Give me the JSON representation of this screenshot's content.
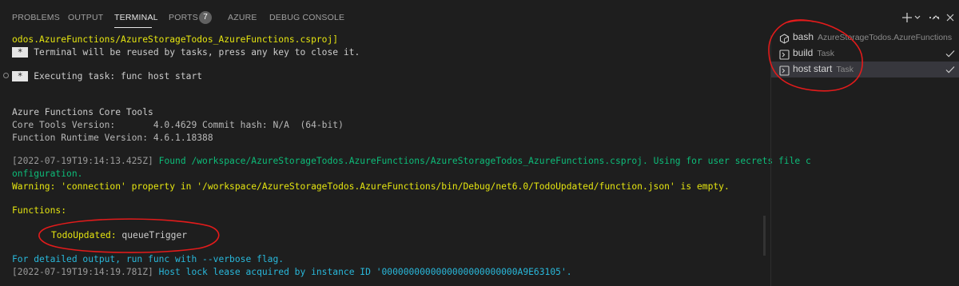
{
  "panel_tabs": {
    "problems": "PROBLEMS",
    "output": "OUTPUT",
    "terminal": "TERMINAL",
    "ports": "PORTS",
    "ports_badge": "7",
    "azure": "AZURE",
    "debug_console": "DEBUG CONSOLE"
  },
  "toolbar_icons": [
    "plus-icon",
    "chevron-down-icon",
    "more-icon",
    "chevron-up-icon",
    "close-icon"
  ],
  "terminal": {
    "line1": "odos.AzureFunctions/AzureStorageTodos_AzureFunctions.csproj]",
    "marker": " * ",
    "reuse_text": " Terminal will be reused by tasks, press any key to close it.",
    "exec_text": " Executing task: func host start",
    "core_tools_title": "Azure Functions Core Tools",
    "core_version": "Core Tools Version:       4.0.4629 Commit hash: N/A  (64-bit)",
    "runtime_version": "Function Runtime Version: 4.6.1.18388",
    "found_ts": "[2022-07-19T19:14:13.425Z]",
    "found_text": " Found /workspace/AzureStorageTodos.AzureFunctions/AzureStorageTodos_AzureFunctions.csproj. Using for user secrets file c",
    "found_text2": "onfiguration.",
    "warning": "Warning: 'connection' property in '/workspace/AzureStorageTodos.AzureFunctions/bin/Debug/net6.0/TodoUpdated/function.json' is empty.",
    "functions_header": "Functions:",
    "function_name": "TodoUpdated:",
    "function_trigger": " queueTrigger",
    "verbose_hint": "For detailed output, run func with --verbose flag.",
    "lock_ts": "[2022-07-19T19:14:19.781Z]",
    "lock_text": " Host lock lease acquired by instance ID '0000000000000000000000000A9E63105'."
  },
  "terminal_list": [
    {
      "name": "bash",
      "desc": "AzureStorageTodos.AzureFunctions",
      "icon": "terminal-bash-icon",
      "checked": false
    },
    {
      "name": "build",
      "desc": "Task",
      "icon": "terminal-task-icon",
      "checked": true
    },
    {
      "name": "host start",
      "desc": "Task",
      "icon": "terminal-task-icon",
      "checked": true
    }
  ],
  "colors": {
    "background": "#1e1e1e",
    "warning_yellow": "#e5e510",
    "info_cyan": "#29b8db",
    "success_green": "#0dbc79",
    "annotation_red": "#e31b1b"
  }
}
